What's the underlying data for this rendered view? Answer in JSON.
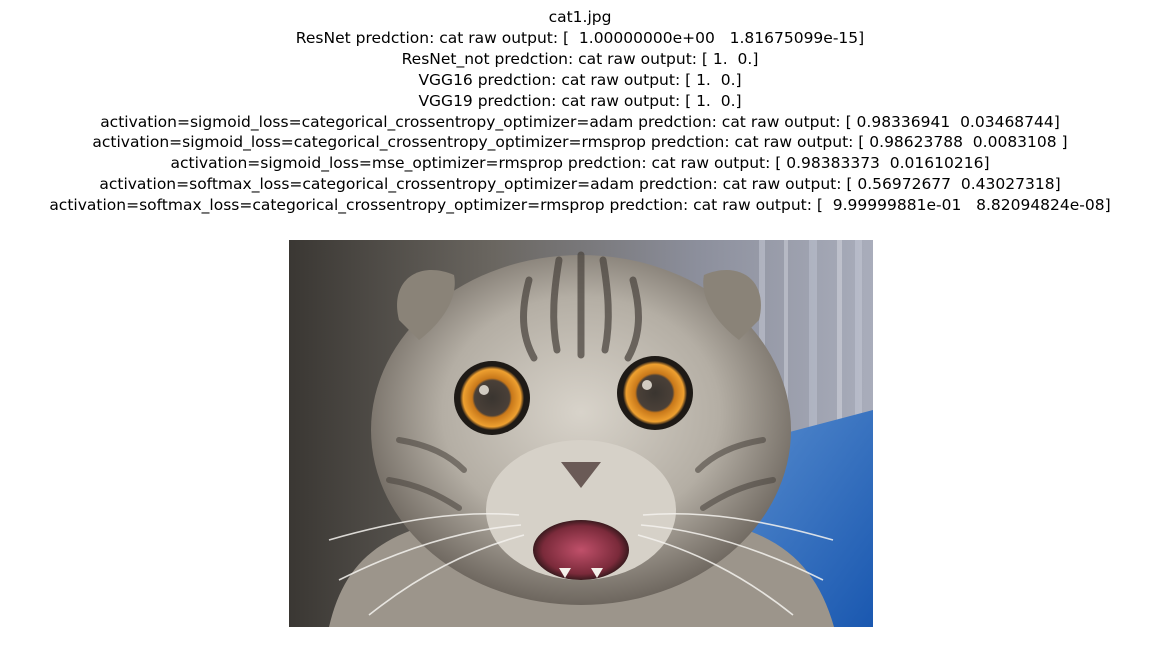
{
  "figure": {
    "title_lines": [
      "cat1.jpg",
      "ResNet predction: cat raw output: [  1.00000000e+00   1.81675099e-15]",
      "ResNet_not predction: cat raw output: [ 1.  0.]",
      "VGG16 predction: cat raw output: [ 1.  0.]",
      "VGG19 predction: cat raw output: [ 1.  0.]",
      "activation=sigmoid_loss=categorical_crossentropy_optimizer=adam predction: cat raw output: [ 0.98336941  0.03468744]",
      "activation=sigmoid_loss=categorical_crossentropy_optimizer=rmsprop predction: cat raw output: [ 0.98623788  0.0083108 ]",
      "activation=sigmoid_loss=mse_optimizer=rmsprop predction: cat raw output: [ 0.98383373  0.01610216]",
      "activation=softmax_loss=categorical_crossentropy_optimizer=adam predction: cat raw output: [ 0.56972677  0.43027318]",
      "activation=softmax_loss=categorical_crossentropy_optimizer=rmsprop predction: cat raw output: [  9.99999881e-01   8.82094824e-08]"
    ]
  },
  "colors": {
    "background": "#ffffff",
    "text": "#000000",
    "fur_light": "#c9c4bc",
    "fur_dark": "#4a4540",
    "eye_iris": "#e08a1a",
    "blanket_blue": "#2a6fc0"
  }
}
